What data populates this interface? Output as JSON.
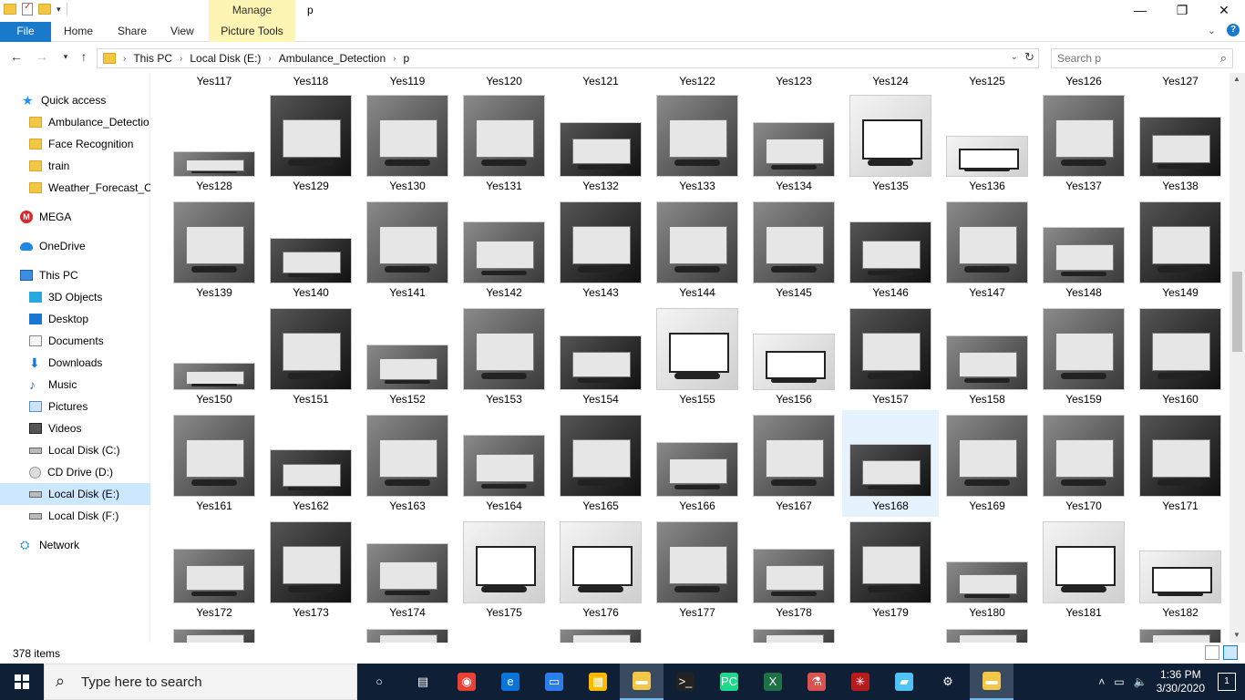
{
  "window": {
    "title": "p",
    "manage_label": "Manage",
    "controls": {
      "minimize": "—",
      "maximize": "❐",
      "close": "✕"
    }
  },
  "ribbon": {
    "tabs": [
      "File",
      "Home",
      "Share",
      "View"
    ],
    "contextual_tab": "Picture Tools",
    "accent_file": "#1979ca",
    "accent_manage": "#fcf5b4"
  },
  "address": {
    "crumbs": [
      "This PC",
      "Local Disk (E:)",
      "Ambulance_Detection",
      "p"
    ],
    "search_placeholder": "Search p"
  },
  "nav": {
    "items": [
      {
        "label": "Quick access",
        "icon": "star-icon"
      },
      {
        "label": "Ambulance_Detectio",
        "icon": "folder-icon"
      },
      {
        "label": "Face Recognition",
        "icon": "folder-icon"
      },
      {
        "label": "train",
        "icon": "folder-icon"
      },
      {
        "label": "Weather_Forecast_Cr",
        "icon": "folder-icon"
      },
      {
        "label": "MEGA",
        "icon": "mega-icon"
      },
      {
        "label": "OneDrive",
        "icon": "cloud-icon"
      },
      {
        "label": "This PC",
        "icon": "computer-icon"
      },
      {
        "label": "3D Objects",
        "icon": "cube-icon"
      },
      {
        "label": "Desktop",
        "icon": "desktop-icon"
      },
      {
        "label": "Documents",
        "icon": "document-icon"
      },
      {
        "label": "Downloads",
        "icon": "download-icon"
      },
      {
        "label": "Music",
        "icon": "music-icon"
      },
      {
        "label": "Pictures",
        "icon": "pictures-icon"
      },
      {
        "label": "Videos",
        "icon": "video-icon"
      },
      {
        "label": "Local Disk (C:)",
        "icon": "drive-icon"
      },
      {
        "label": "CD Drive (D:)",
        "icon": "cd-icon"
      },
      {
        "label": "Local Disk (E:)",
        "icon": "drive-icon"
      },
      {
        "label": "Local Disk (F:)",
        "icon": "drive-icon"
      },
      {
        "label": "Network",
        "icon": "network-icon"
      }
    ],
    "selected_label": "Local Disk (E:)"
  },
  "files": {
    "top_row_labels": [
      "Yes117",
      "Yes118",
      "Yes119",
      "Yes120",
      "Yes121",
      "Yes122",
      "Yes123",
      "Yes124",
      "Yes125",
      "Yes126",
      "Yes127"
    ],
    "rows": [
      [
        "Yes128",
        "Yes129",
        "Yes130",
        "Yes131",
        "Yes132",
        "Yes133",
        "Yes134",
        "Yes135",
        "Yes136",
        "Yes137",
        "Yes138"
      ],
      [
        "Yes139",
        "Yes140",
        "Yes141",
        "Yes142",
        "Yes143",
        "Yes144",
        "Yes145",
        "Yes146",
        "Yes147",
        "Yes148",
        "Yes149"
      ],
      [
        "Yes150",
        "Yes151",
        "Yes152",
        "Yes153",
        "Yes154",
        "Yes155",
        "Yes156",
        "Yes157",
        "Yes158",
        "Yes159",
        "Yes160"
      ],
      [
        "Yes161",
        "Yes162",
        "Yes163",
        "Yes164",
        "Yes165",
        "Yes166",
        "Yes167",
        "Yes168",
        "Yes169",
        "Yes170",
        "Yes171"
      ],
      [
        "Yes172",
        "Yes173",
        "Yes174",
        "Yes175",
        "Yes176",
        "Yes177",
        "Yes178",
        "Yes179",
        "Yes180",
        "Yes181",
        "Yes182"
      ]
    ],
    "selected": "Yes168"
  },
  "status": {
    "item_count": "378 items"
  },
  "taskbar": {
    "search_placeholder": "Type here to search",
    "apps": [
      "cortana-icon",
      "task-view-icon",
      "chrome-icon",
      "edge-icon",
      "network-share-icon",
      "store-icon",
      "file-explorer-icon",
      "terminal-icon",
      "pycharm-icon",
      "excel-icon",
      "lab-icon",
      "spider-icon",
      "notes-icon",
      "settings-icon",
      "file-manager-icon"
    ],
    "time": "1:36 PM",
    "date": "3/30/2020",
    "notification_count": "1"
  }
}
